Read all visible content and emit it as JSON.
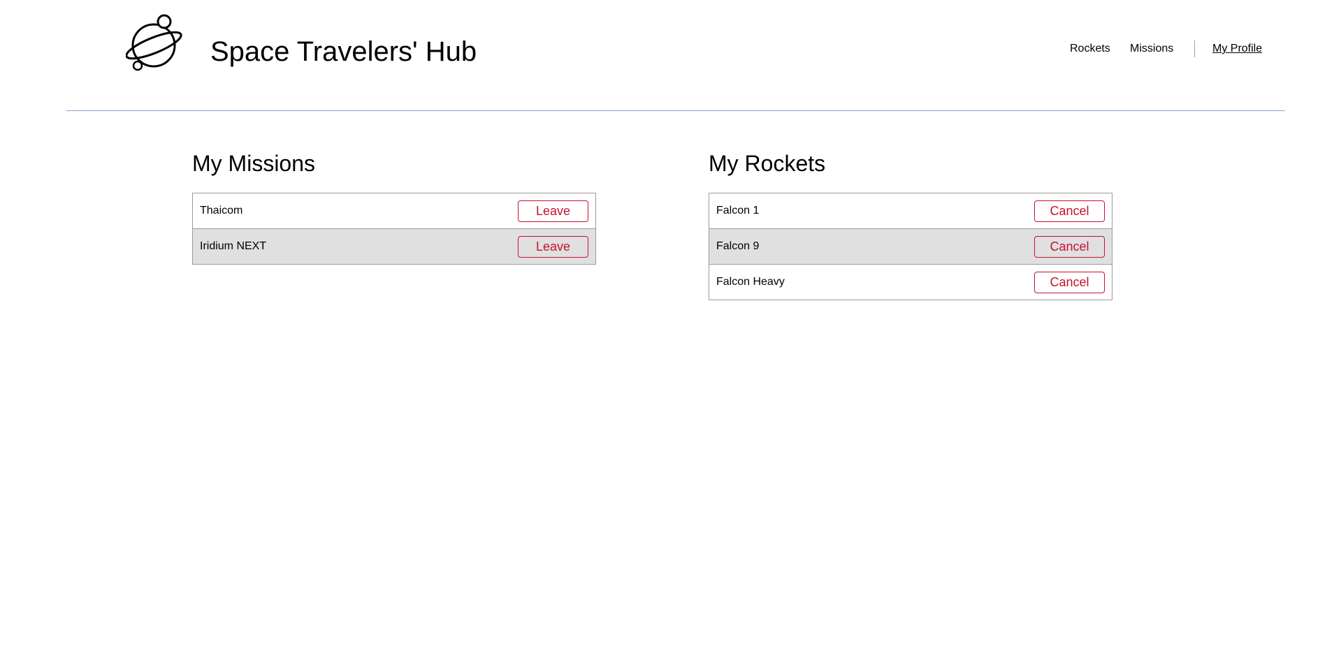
{
  "header": {
    "title": "Space Travelers' Hub",
    "logo_icon": "planet-icon",
    "nav": [
      {
        "label": "Rockets"
      },
      {
        "label": "Missions"
      },
      {
        "label": "My Profile",
        "active": true
      }
    ]
  },
  "missions": {
    "title": "My Missions",
    "items": [
      {
        "name": "Thaicom",
        "action": "Leave"
      },
      {
        "name": "Iridium NEXT",
        "action": "Leave"
      }
    ]
  },
  "rockets": {
    "title": "My Rockets",
    "items": [
      {
        "name": "Falcon 1",
        "action": "Cancel"
      },
      {
        "name": "Falcon 9",
        "action": "Cancel"
      },
      {
        "name": "Falcon Heavy",
        "action": "Cancel"
      }
    ]
  },
  "colors": {
    "accent_red": "#c8102e",
    "divider_blue": "#8aa4c8",
    "row_alt": "#e0e0e0",
    "border": "#9a9a9a"
  }
}
